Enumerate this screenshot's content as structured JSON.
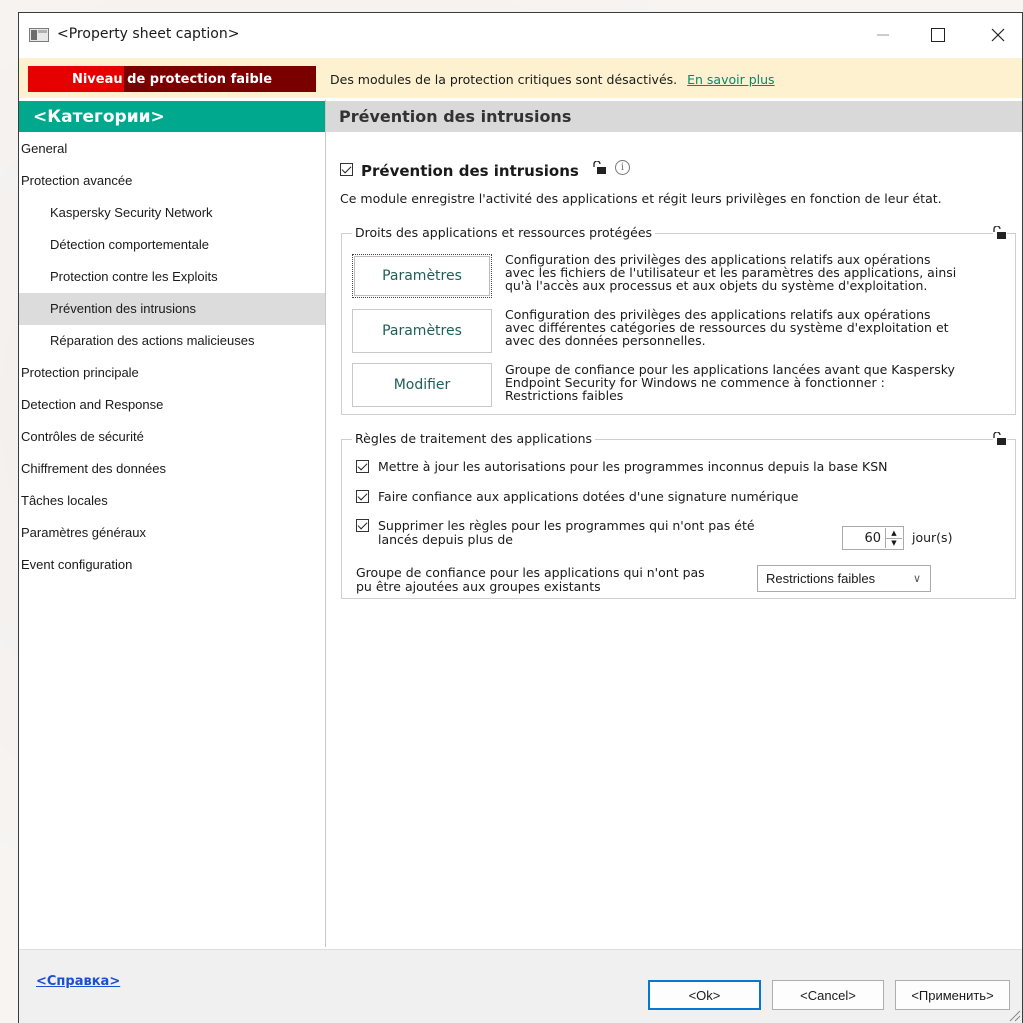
{
  "window": {
    "title": "<Property sheet caption>",
    "minimize_label": "—",
    "maximize_label": "☐",
    "close_label": "✕"
  },
  "status": {
    "badge": "Niveau de protection faible",
    "message": "Des modules de la protection critiques sont désactivés.",
    "link": "En savoir plus",
    "badge_color_left": "#e60000",
    "badge_color_right": "#7a0000"
  },
  "sidebar": {
    "header": "<Категории>",
    "header_color": "#00a88e",
    "items": [
      {
        "label": "General",
        "level": 0
      },
      {
        "label": "Protection avancée",
        "level": 0
      },
      {
        "label": "Kaspersky Security Network",
        "level": 1
      },
      {
        "label": "Détection comportementale",
        "level": 1
      },
      {
        "label": "Protection contre les Exploits",
        "level": 1
      },
      {
        "label": "Prévention des intrusions",
        "level": 1,
        "selected": true
      },
      {
        "label": "Réparation des actions malicieuses",
        "level": 1
      },
      {
        "label": "Protection principale",
        "level": 0
      },
      {
        "label": "Detection and Response",
        "level": 0
      },
      {
        "label": "Contrôles de sécurité",
        "level": 0
      },
      {
        "label": "Chiffrement des données",
        "level": 0
      },
      {
        "label": "Tâches locales",
        "level": 0
      },
      {
        "label": "Paramètres généraux",
        "level": 0
      },
      {
        "label": "Event configuration",
        "level": 0
      }
    ]
  },
  "main": {
    "header": "Prévention des intrusions",
    "module_title": "Prévention des intrusions",
    "module_enabled": true,
    "description": "Ce module enregistre l'activité des applications et régit leurs privilèges en fonction de leur état.",
    "rights_group": {
      "legend": "Droits des applications et ressources protégées",
      "rows": [
        {
          "button": "Paramètres",
          "desc1": "Configuration des privilèges des applications relatifs aux opérations",
          "desc2": "avec les fichiers de l'utilisateur et les paramètres des applications, ainsi",
          "desc3": "qu'à l'accès aux processus et aux objets du système d'exploitation."
        },
        {
          "button": "Paramètres",
          "desc1": "Configuration des privilèges des applications relatifs aux opérations",
          "desc2": "avec différentes catégories de ressources du système d'exploitation et",
          "desc3": "avec des données personnelles."
        },
        {
          "button": "Modifier",
          "desc1": "Groupe de confiance pour les applications lancées avant que Kaspersky",
          "desc2": "Endpoint Security for Windows ne commence à fonctionner :",
          "desc3": "Restrictions faibles"
        }
      ]
    },
    "rules_group": {
      "legend": "Règles de traitement des applications",
      "update_ksn": "Mettre à jour les autorisations pour les programmes inconnus depuis la base KSN",
      "update_ksn_checked": true,
      "trust_signed": "Faire confiance aux applications dotées d'une signature numérique",
      "trust_signed_checked": true,
      "delete_rules_line1": "Supprimer les règles pour les programmes qui n'ont pas été",
      "delete_rules_line2": "lancés depuis plus de",
      "delete_rules_checked": true,
      "days_value": "60",
      "days_unit": "jour(s)",
      "trust_group_line1": "Groupe de confiance pour les applications qui n'ont pas",
      "trust_group_line2": "pu être ajoutées aux groupes existants",
      "trust_group_value": "Restrictions faibles"
    }
  },
  "footer": {
    "help": "<Справка>",
    "ok": "<Ok>",
    "cancel": "<Cancel>",
    "apply": "<Применить>"
  }
}
